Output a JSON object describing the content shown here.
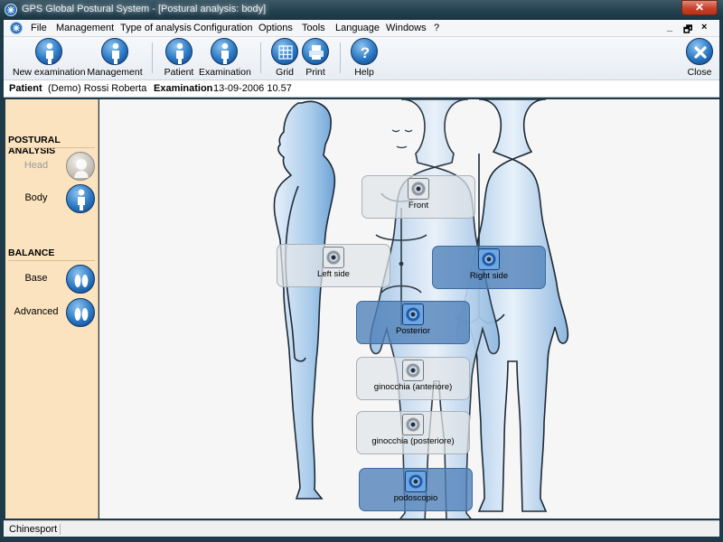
{
  "window": {
    "title": "GPS Global Postural System - [Postural analysis: body]",
    "close_glyph": "✕"
  },
  "menu": {
    "items": [
      "File",
      "Management",
      "Type of analysis",
      "Configuration",
      "Options",
      "Tools",
      "Language",
      "Windows",
      "?"
    ],
    "controls": [
      "_",
      "🗗",
      "×"
    ]
  },
  "toolbar": {
    "buttons": [
      "New examination",
      "Management",
      "Patient",
      "Examination",
      "Grid",
      "Print",
      "Help"
    ],
    "close_label": "Close"
  },
  "patient_bar": {
    "patient_label": "Patient",
    "patient_value": "(Demo) Rossi Roberta",
    "examination_label": "Examination",
    "examination_value": "13-09-2006 10.57"
  },
  "sidebar": {
    "section1": "POSTURAL ANALYSIS",
    "head": "Head",
    "body": "Body",
    "section2": "BALANCE",
    "base": "Base",
    "advanced": "Advanced"
  },
  "zones": {
    "front": "Front",
    "left_side": "Left side",
    "right_side": "Right side",
    "posterior": "Posterior",
    "knee_front": "ginocchia (anteriore)",
    "knee_back": "ginocchia (posteriore)",
    "podoscopio": "podoscopio"
  },
  "status": {
    "text": "Chinesport"
  },
  "colors": {
    "sidebar": "#fbe3bf",
    "accent_blue": "#2a78c4",
    "zone_selected": "#4e80b8"
  },
  "icons": [
    "app-logo-icon",
    "person-icon",
    "grid-icon",
    "print-icon",
    "help-icon",
    "close-icon",
    "camera-target-icon",
    "feet-icon"
  ]
}
